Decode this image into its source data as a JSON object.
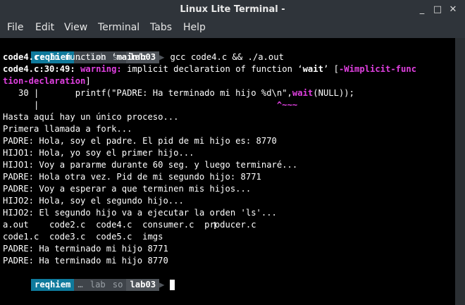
{
  "window": {
    "title": "Linux Lite Terminal -",
    "min": "_",
    "max": "□",
    "close": "✕"
  },
  "menu": [
    "File",
    "Edit",
    "View",
    "Terminal",
    "Tabs",
    "Help"
  ],
  "prompt": {
    "user": "reqhiem",
    "ell": "…",
    "p1": "lab",
    "p2": "so",
    "p3": "lab03",
    "sep": "❯"
  },
  "command": "gcc code4.c && ./a.out",
  "colors": {
    "prompt_user_bg": "#0f7a9c",
    "prompt_path_bg": "#4a4f55",
    "prompt_last_bg": "#5c6167",
    "warning": "#e040e0"
  },
  "out": {
    "l1a": "code4.c:",
    "l1b": " In function ‘",
    "l1c": "main",
    "l1d": "’:",
    "l2a": "code4.c:30:49: ",
    "l2b": "warning: ",
    "l2c": "implicit declaration of function ‘",
    "l2d": "wait",
    "l2e": "’ [",
    "l2f": "-Wimplicit-func",
    "l3a": "tion-declaration",
    "l3b": "]",
    "l4a": "   30 |       printf(\"PADRE: Ha terminado mi hijo %d\\n\",",
    "l4b": "wait",
    "l4c": "(NULL));",
    "l5a": "      |                                              ",
    "l5b": "^~~~",
    "rows": [
      "Hasta aquí hay un único proceso...",
      "Primera llamada a fork...",
      "PADRE: Hola, soy el padre. El pid de mi hijo es: 8770",
      "HIJO1: Hola, yo soy el primer hijo...",
      "HIJO1: Voy a pararme durante 60 seg. y luego terminaré...",
      "PADRE: Hola otra vez. Pid de mi segundo hijo: 8771",
      "PADRE: Voy a esperar a que terminen mis hijos...",
      "HIJO2: Hola, soy el segundo hijo...",
      "HIJO2: El segundo hijo va a ejecutar la orden 'ls'...",
      "a.out    code2.c  code4.c  consumer.c  producer.c",
      "code1.c  code3.c  code5.c  imgs",
      "PADRE: Ha terminado mi hijo 8771",
      "PADRE: Ha terminado mi hijo 8770"
    ]
  }
}
